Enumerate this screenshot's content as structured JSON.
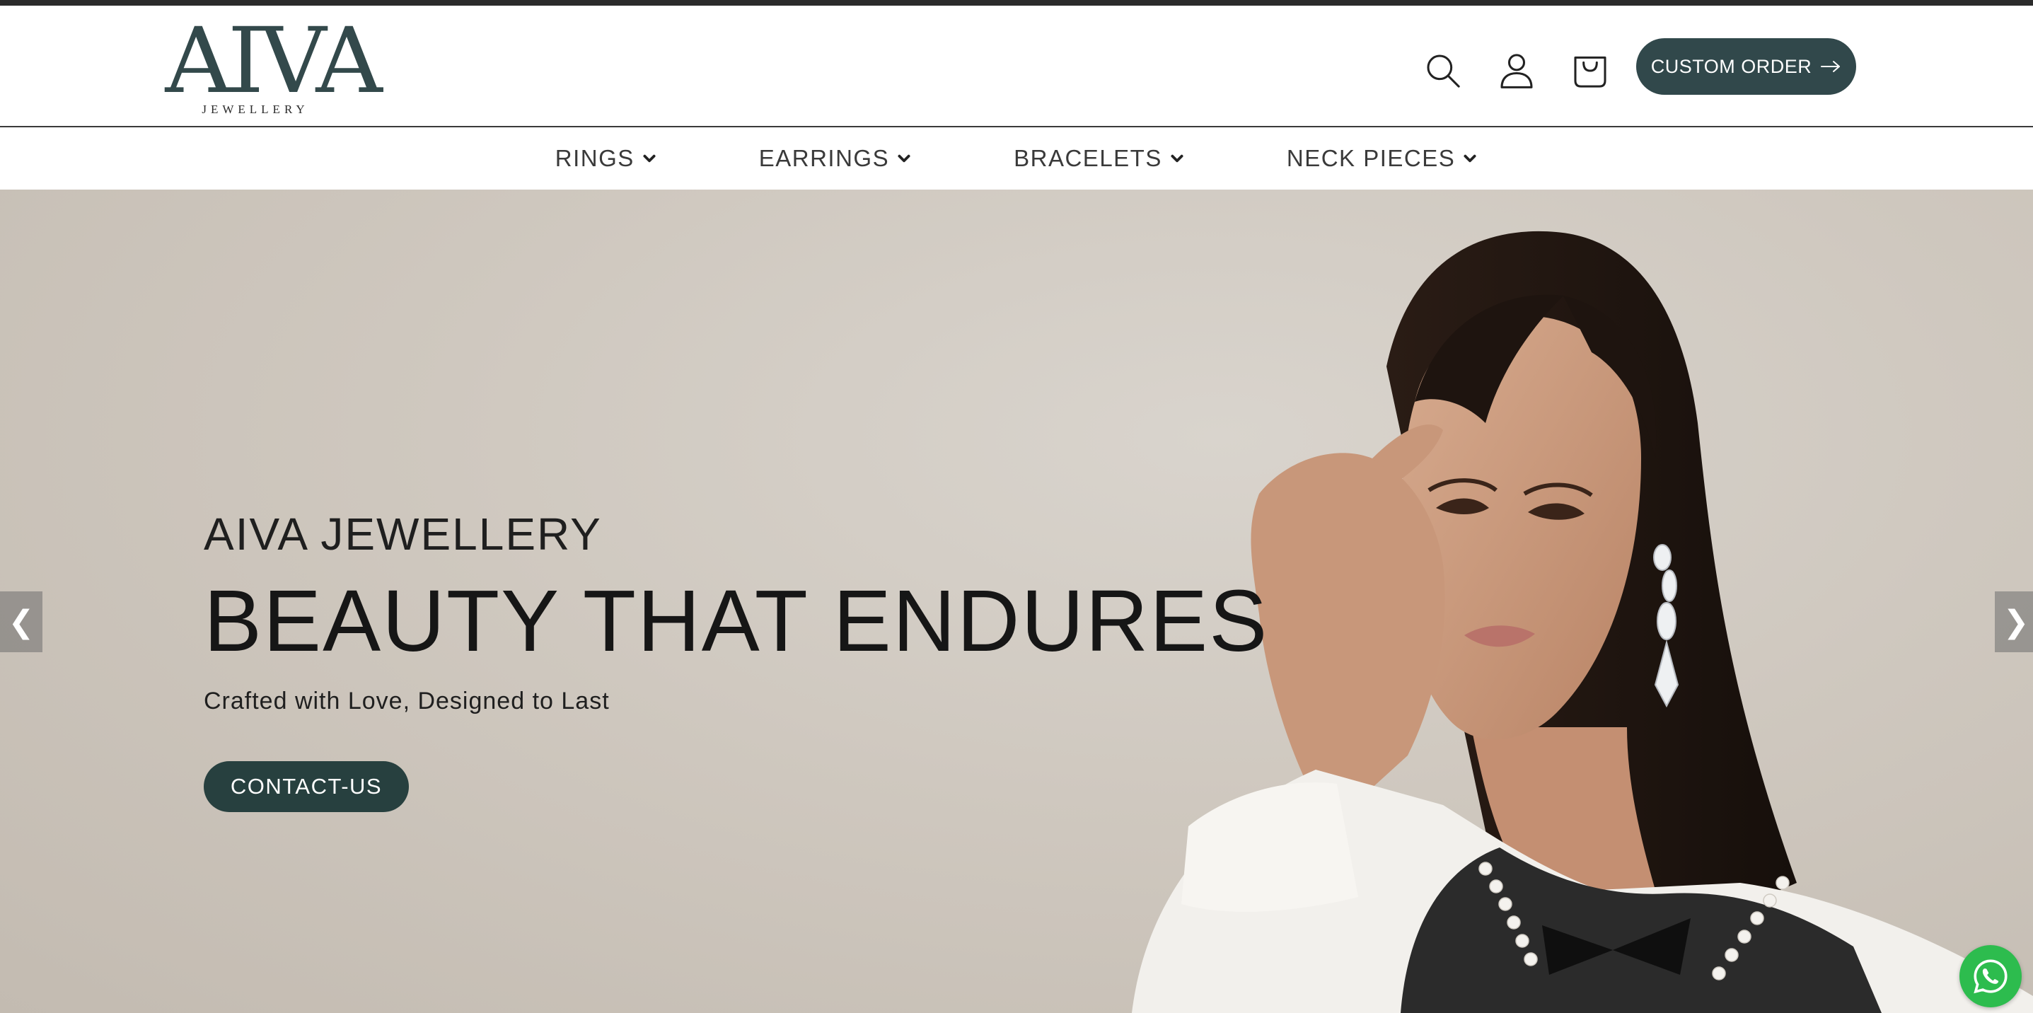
{
  "brand": {
    "logo_mark": "AIVA",
    "logo_subtitle": "JEWELLERY"
  },
  "header": {
    "icons": [
      "search-icon",
      "user-icon",
      "bag-icon"
    ],
    "custom_order_label": "CUSTOM ORDER"
  },
  "nav": {
    "items": [
      {
        "label": "RINGS"
      },
      {
        "label": "EARRINGS"
      },
      {
        "label": "BRACELETS"
      },
      {
        "label": "NECK PIECES"
      }
    ]
  },
  "hero": {
    "eyebrow": "AIVA JEWELLERY",
    "headline": "BEAUTY THAT ENDURES",
    "tagline": "Crafted with Love, Designed to Last",
    "cta_label": "CONTACT-US",
    "prev_label": "❮",
    "next_label": "❯"
  },
  "colors": {
    "brand_teal": "#31484b",
    "hero_bg": "#cfc8bf",
    "whatsapp_green": "#2dbc4e",
    "top_bar": "#2b2b2b"
  }
}
